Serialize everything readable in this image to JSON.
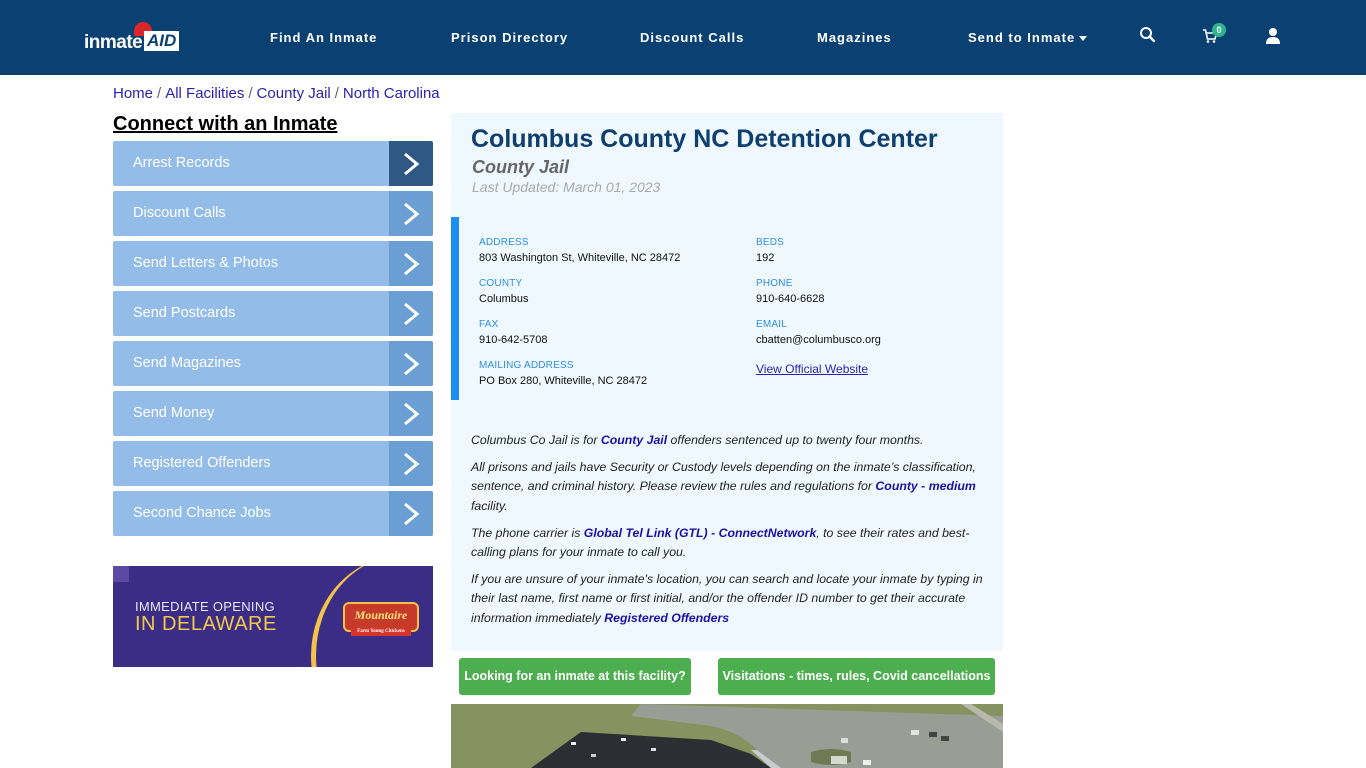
{
  "header": {
    "logo_text": "inmate",
    "logo_accent": "AID",
    "nav": [
      {
        "label": "Find An Inmate"
      },
      {
        "label": "Prison Directory"
      },
      {
        "label": "Discount Calls"
      },
      {
        "label": "Magazines"
      },
      {
        "label": "Send to Inmate",
        "has_dropdown": true
      }
    ],
    "icons": {
      "search": "search-icon",
      "cart": "cart-icon",
      "user": "user-icon"
    },
    "cart_count": "0",
    "colors": {
      "bar": "#0b4172",
      "badge": "#2fb48c"
    }
  },
  "breadcrumb": [
    "Home",
    "All Facilities",
    "County Jail",
    "North Carolina"
  ],
  "breadcrumb_sep": "/",
  "sidebar": {
    "title": "Connect with an Inmate",
    "items": [
      {
        "label": "Arrest Records",
        "active": true
      },
      {
        "label": "Discount Calls"
      },
      {
        "label": "Send Letters & Photos"
      },
      {
        "label": "Send Postcards"
      },
      {
        "label": "Send Magazines"
      },
      {
        "label": "Send Money"
      },
      {
        "label": "Registered Offenders"
      },
      {
        "label": "Second Chance Jobs"
      }
    ],
    "ad": {
      "line1": "IMMEDIATE OPENING",
      "line2": "IN DELAWARE",
      "brand": "Mountaire",
      "brand_tag": "Farm Young Chickens"
    }
  },
  "facility": {
    "name": "Columbus County NC Detention Center",
    "type": "County Jail",
    "last_updated": "Last Updated: March 01, 2023",
    "fields": {
      "address": {
        "label": "ADDRESS",
        "value": "803 Washington St, Whiteville, NC 28472"
      },
      "county": {
        "label": "COUNTY",
        "value": "Columbus"
      },
      "fax": {
        "label": "FAX",
        "value": "910-642-5708"
      },
      "mailing": {
        "label": "MAILING ADDRESS",
        "value": "PO Box 280, Whiteville, NC 28472"
      },
      "beds": {
        "label": "BEDS",
        "value": "192"
      },
      "phone": {
        "label": "PHONE",
        "value": "910-640-6628"
      },
      "email": {
        "label": "EMAIL",
        "value": "cbatten@columbusco.org"
      }
    },
    "website_link": "View Official Website"
  },
  "description": {
    "p1": {
      "pre": "Columbus Co Jail is for ",
      "link": "County Jail",
      "post": " offenders sentenced up to twenty four months."
    },
    "p2": {
      "pre": "All prisons and jails have Security or Custody levels depending on the inmate’s classification, sentence, and criminal history. Please review the rules and regulations for ",
      "link": "County - medium",
      "post": " facility."
    },
    "p3": {
      "pre": "The phone carrier is ",
      "link": "Global Tel Link (GTL) - ConnectNetwork",
      "post": ", to see their rates and best-calling plans for your inmate to call you."
    },
    "p4": {
      "pre": "If you are unsure of your inmate's location, you can search and locate your inmate by typing in their last name, first name or first initial, and/or the offender ID number to get their accurate information immediately ",
      "link": "Registered Offenders",
      "post": ""
    }
  },
  "buttons": {
    "find_inmate": "Looking for an inmate at this facility?",
    "visitation": "Visitations - times, rules, Covid cancellations"
  },
  "photo": {
    "alt": "aerial-facility-photo"
  }
}
